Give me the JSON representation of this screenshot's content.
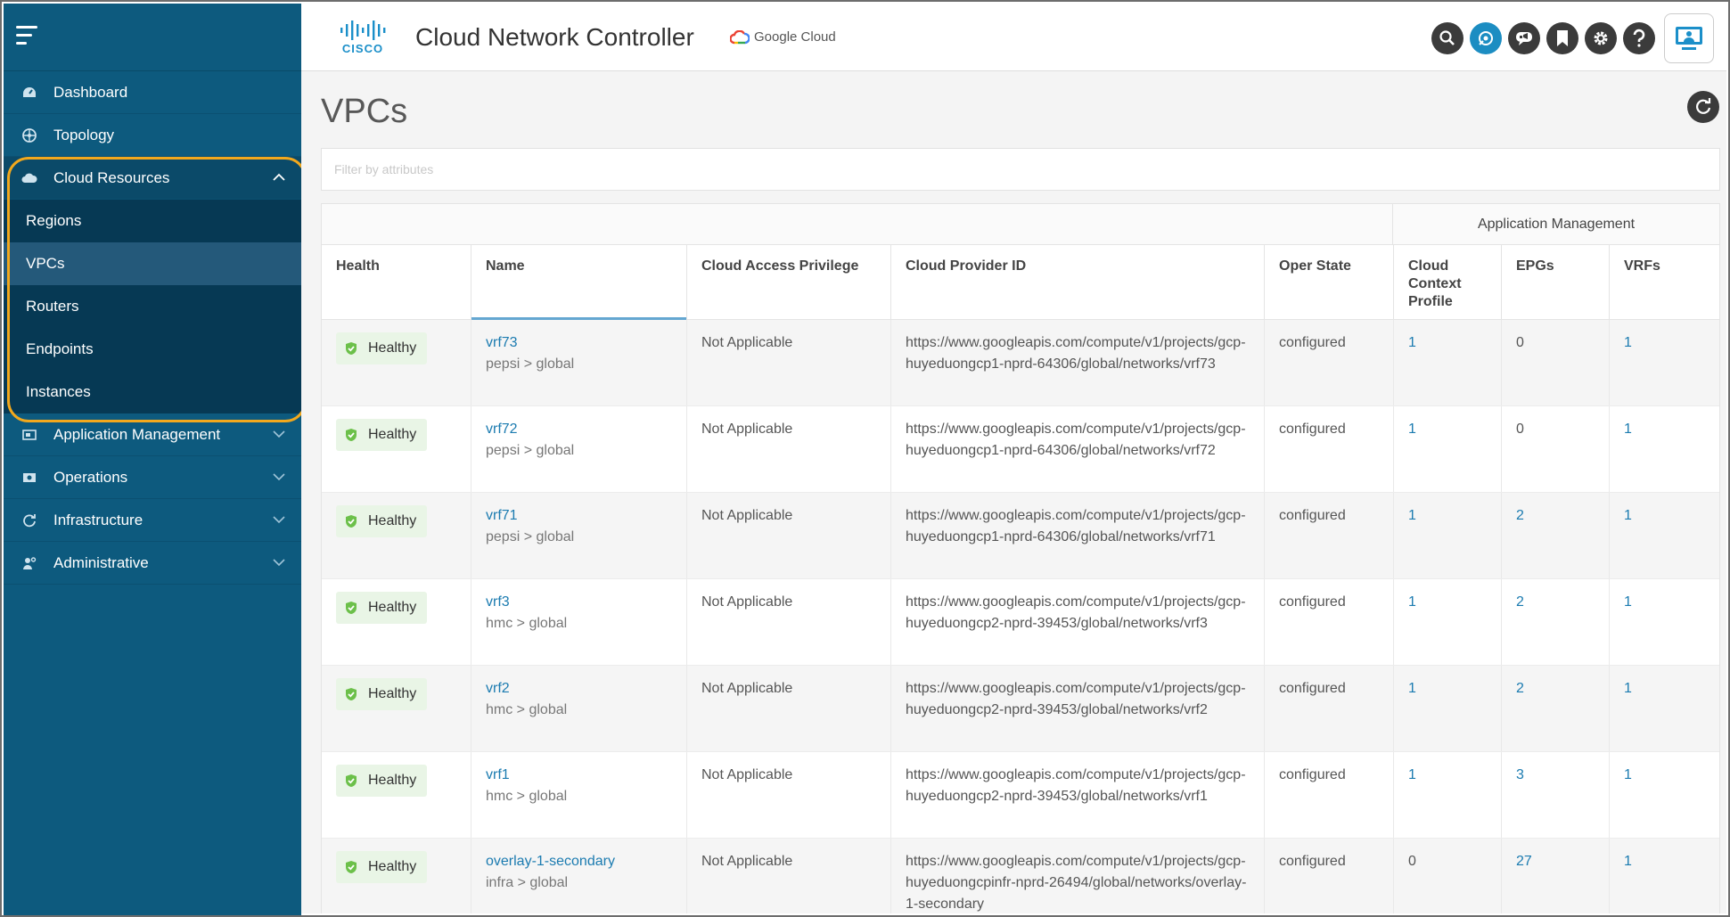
{
  "header": {
    "app_title": "Cloud Network Controller",
    "google_cloud_label": "Google Cloud",
    "cisco_label": "CISCO"
  },
  "sidebar": {
    "items": [
      {
        "label": "Dashboard",
        "icon": "dashboard-icon"
      },
      {
        "label": "Topology",
        "icon": "topology-icon"
      },
      {
        "label": "Cloud Resources",
        "icon": "cloud-icon",
        "expanded": true,
        "subitems": [
          "Regions",
          "VPCs",
          "Routers",
          "Endpoints",
          "Instances"
        ],
        "active_subitem": "VPCs"
      },
      {
        "label": "Application Management",
        "icon": "application-icon"
      },
      {
        "label": "Operations",
        "icon": "operations-icon"
      },
      {
        "label": "Infrastructure",
        "icon": "infrastructure-icon"
      },
      {
        "label": "Administrative",
        "icon": "administrative-icon"
      }
    ]
  },
  "main": {
    "page_title": "VPCs",
    "filter_placeholder": "Filter by attributes",
    "group_header": "Application Management",
    "columns": [
      "Health",
      "Name",
      "Cloud Access Privilege",
      "Cloud Provider ID",
      "Oper State",
      "Cloud Context Profile",
      "EPGs",
      "VRFs"
    ],
    "rows": [
      {
        "health": "Healthy",
        "name": "vrf73",
        "path": "pepsi > global",
        "access": "Not Applicable",
        "provider_id": "https://www.googleapis.com/compute/v1/projects/gcp-huyeduongcp1-nprd-64306/global/networks/vrf73",
        "oper_state": "configured",
        "ccp": "1",
        "epgs": "0",
        "vrfs": "1"
      },
      {
        "health": "Healthy",
        "name": "vrf72",
        "path": "pepsi > global",
        "access": "Not Applicable",
        "provider_id": "https://www.googleapis.com/compute/v1/projects/gcp-huyeduongcp1-nprd-64306/global/networks/vrf72",
        "oper_state": "configured",
        "ccp": "1",
        "epgs": "0",
        "vrfs": "1"
      },
      {
        "health": "Healthy",
        "name": "vrf71",
        "path": "pepsi > global",
        "access": "Not Applicable",
        "provider_id": "https://www.googleapis.com/compute/v1/projects/gcp-huyeduongcp1-nprd-64306/global/networks/vrf71",
        "oper_state": "configured",
        "ccp": "1",
        "epgs": "2",
        "vrfs": "1"
      },
      {
        "health": "Healthy",
        "name": "vrf3",
        "path": "hmc > global",
        "access": "Not Applicable",
        "provider_id": "https://www.googleapis.com/compute/v1/projects/gcp-huyeduongcp2-nprd-39453/global/networks/vrf3",
        "oper_state": "configured",
        "ccp": "1",
        "epgs": "2",
        "vrfs": "1"
      },
      {
        "health": "Healthy",
        "name": "vrf2",
        "path": "hmc > global",
        "access": "Not Applicable",
        "provider_id": "https://www.googleapis.com/compute/v1/projects/gcp-huyeduongcp2-nprd-39453/global/networks/vrf2",
        "oper_state": "configured",
        "ccp": "1",
        "epgs": "2",
        "vrfs": "1"
      },
      {
        "health": "Healthy",
        "name": "vrf1",
        "path": "hmc > global",
        "access": "Not Applicable",
        "provider_id": "https://www.googleapis.com/compute/v1/projects/gcp-huyeduongcp2-nprd-39453/global/networks/vrf1",
        "oper_state": "configured",
        "ccp": "1",
        "epgs": "3",
        "vrfs": "1"
      },
      {
        "health": "Healthy",
        "name": "overlay-1-secondary",
        "path": "infra > global",
        "access": "Not Applicable",
        "provider_id": "https://www.googleapis.com/compute/v1/projects/gcp-huyeduongcpinfr-nprd-26494/global/networks/overlay-1-secondary",
        "oper_state": "configured",
        "ccp": "0",
        "epgs": "27",
        "vrfs": "1"
      }
    ]
  },
  "colors": {
    "sidebar_bg": "#0d5a7e",
    "highlight": "#f2a81d",
    "link": "#1b7bb0",
    "healthy_green": "#6cc04a"
  }
}
